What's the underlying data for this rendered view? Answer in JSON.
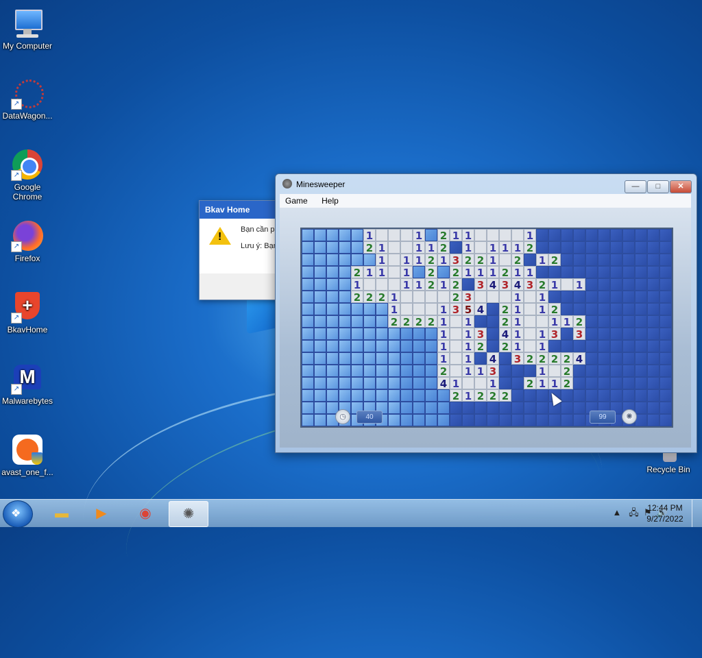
{
  "desktop": {
    "icons": [
      {
        "label": "My Computer"
      },
      {
        "label": "DataWagon..."
      },
      {
        "label": "Google\nChrome"
      },
      {
        "label": "Firefox"
      },
      {
        "label": "BkavHome"
      },
      {
        "label": "Malwarebytes"
      },
      {
        "label": "avast_one_f..."
      },
      {
        "label": "Recycle Bin"
      }
    ]
  },
  "bkav_dialog": {
    "title": "Bkav Home",
    "line1": "Bạn cần ph",
    "line2": "Lưu ý: Bạn"
  },
  "minesweeper": {
    "title": "Minesweeper",
    "menu": [
      "Game",
      "Help"
    ],
    "time": "40",
    "mines_left": "99",
    "board_rows": [
      "CCCCC1...1C211..,.1CCCCCCCCCCC",
      "CCCCC21..112C1.1112CCCCCCCCCCC",
      "CCCCCC1.11213221.2C12CCCCCCCCC",
      "CCCC211.1C2C2111211CCCCCCCCCCC",
      "CCCC1...11212C3434321.1CCCCCCC",
      "CCCC2221....23...1.1CCCCCCCCCC",
      "CCCCCCC1...1354C21.12CCCCCCCCC",
      "CCCCCCC22221.1CC21..112CCCCCCC",
      "CCCCCCCCCCC1.13C41.13C3CCCCCCC",
      "CCCCCCCCCCC1.12C21.1CCCCCCCCCC",
      "CCCCCCCCCCC1.1C4C322224CCCCCCC",
      "CCCCCCCCCCC2.113CCC1.2CCCCCCCC",
      "CCCCCCCCCCC41..1CC2112CCCCCCCC",
      "CCCCCCCCCCCC21222CCCCCCCCCCCCC",
      "CCCCCCCCCCCCCCCCCCCCCCCCCCCCCC",
      "CCCCCCCCCCCCCCCCCCCCCCCCCCCCCC"
    ],
    "number_colors": {
      "1": "#3a3aa8",
      "2": "#277a2b",
      "3": "#b0242a",
      "4": "#1c1c7a",
      "5": "#7a1010"
    },
    "covered_light": "#6aa4e6",
    "covered_dark": "#3a5fbf"
  },
  "taskbar": {
    "items": [
      "explorer",
      "media-player",
      "chrome",
      "minesweeper"
    ],
    "time": "12:44 PM",
    "date": "9/27/2022"
  }
}
